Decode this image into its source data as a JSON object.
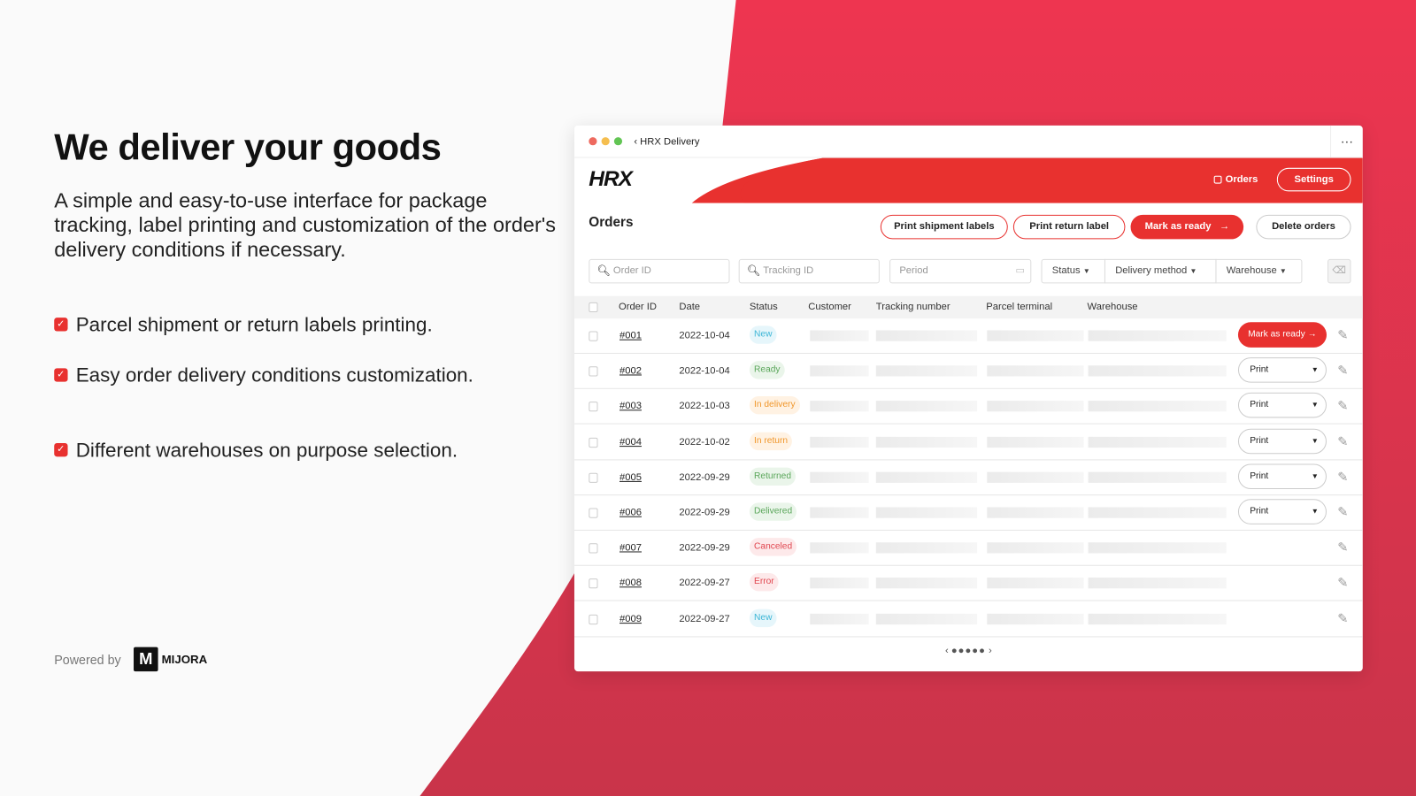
{
  "colors": {
    "brand_red": "#e8312f",
    "bg_red_top": "#ee3550",
    "bg_red_bottom": "#c9344a"
  },
  "hero": {
    "title": "We deliver your goods",
    "description": "A simple and easy-to-use interface for package tracking, label printing and customization of the order's delivery conditions if necessary."
  },
  "features": [
    {
      "text": "Parcel shipment or return labels printing.",
      "icon": "checkbox-checked-icon"
    },
    {
      "text": "Easy order delivery conditions customization.",
      "icon": "checkbox-checked-icon"
    },
    {
      "text": "Different warehouses on purpose selection.",
      "icon": "checkbox-checked-icon"
    }
  ],
  "powered": {
    "label": "Powered by",
    "logo_letter": "M",
    "brand": "MIJORA"
  },
  "window": {
    "back_label": "‹ HRX Delivery",
    "more": "···"
  },
  "brand": {
    "logo": "HRX",
    "nav_orders": "Orders",
    "settings": "Settings"
  },
  "page": {
    "title": "Orders"
  },
  "actions": {
    "print_shipment": "Print shipment labels",
    "print_return": "Print return label",
    "mark_ready": "Mark as ready",
    "delete": "Delete orders"
  },
  "filters": {
    "order_id_placeholder": "Order ID",
    "tracking_placeholder": "Tracking ID",
    "period_placeholder": "Period",
    "status": "Status",
    "delivery_method": "Delivery method",
    "warehouse": "Warehouse"
  },
  "table": {
    "columns": [
      "Order ID",
      "Date",
      "Status",
      "Customer",
      "Tracking number",
      "Parcel terminal",
      "Warehouse"
    ],
    "rows": [
      {
        "id": "#001",
        "date": "2022-10-04",
        "status": "New",
        "action": "Mark as ready"
      },
      {
        "id": "#002",
        "date": "2022-10-04",
        "status": "Ready",
        "action": "Print"
      },
      {
        "id": "#003",
        "date": "2022-10-03",
        "status": "In delivery",
        "action": "Print"
      },
      {
        "id": "#004",
        "date": "2022-10-02",
        "status": "In return",
        "action": "Print"
      },
      {
        "id": "#005",
        "date": "2022-09-29",
        "status": "Returned",
        "action": "Print"
      },
      {
        "id": "#006",
        "date": "2022-09-29",
        "status": "Delivered",
        "action": "Print"
      },
      {
        "id": "#007",
        "date": "2022-09-29",
        "status": "Canceled",
        "action": ""
      },
      {
        "id": "#008",
        "date": "2022-09-27",
        "status": "Error",
        "action": ""
      },
      {
        "id": "#009",
        "date": "2022-09-27",
        "status": "New",
        "action": ""
      }
    ]
  },
  "pagination": {
    "pages": 5,
    "current": 1
  }
}
